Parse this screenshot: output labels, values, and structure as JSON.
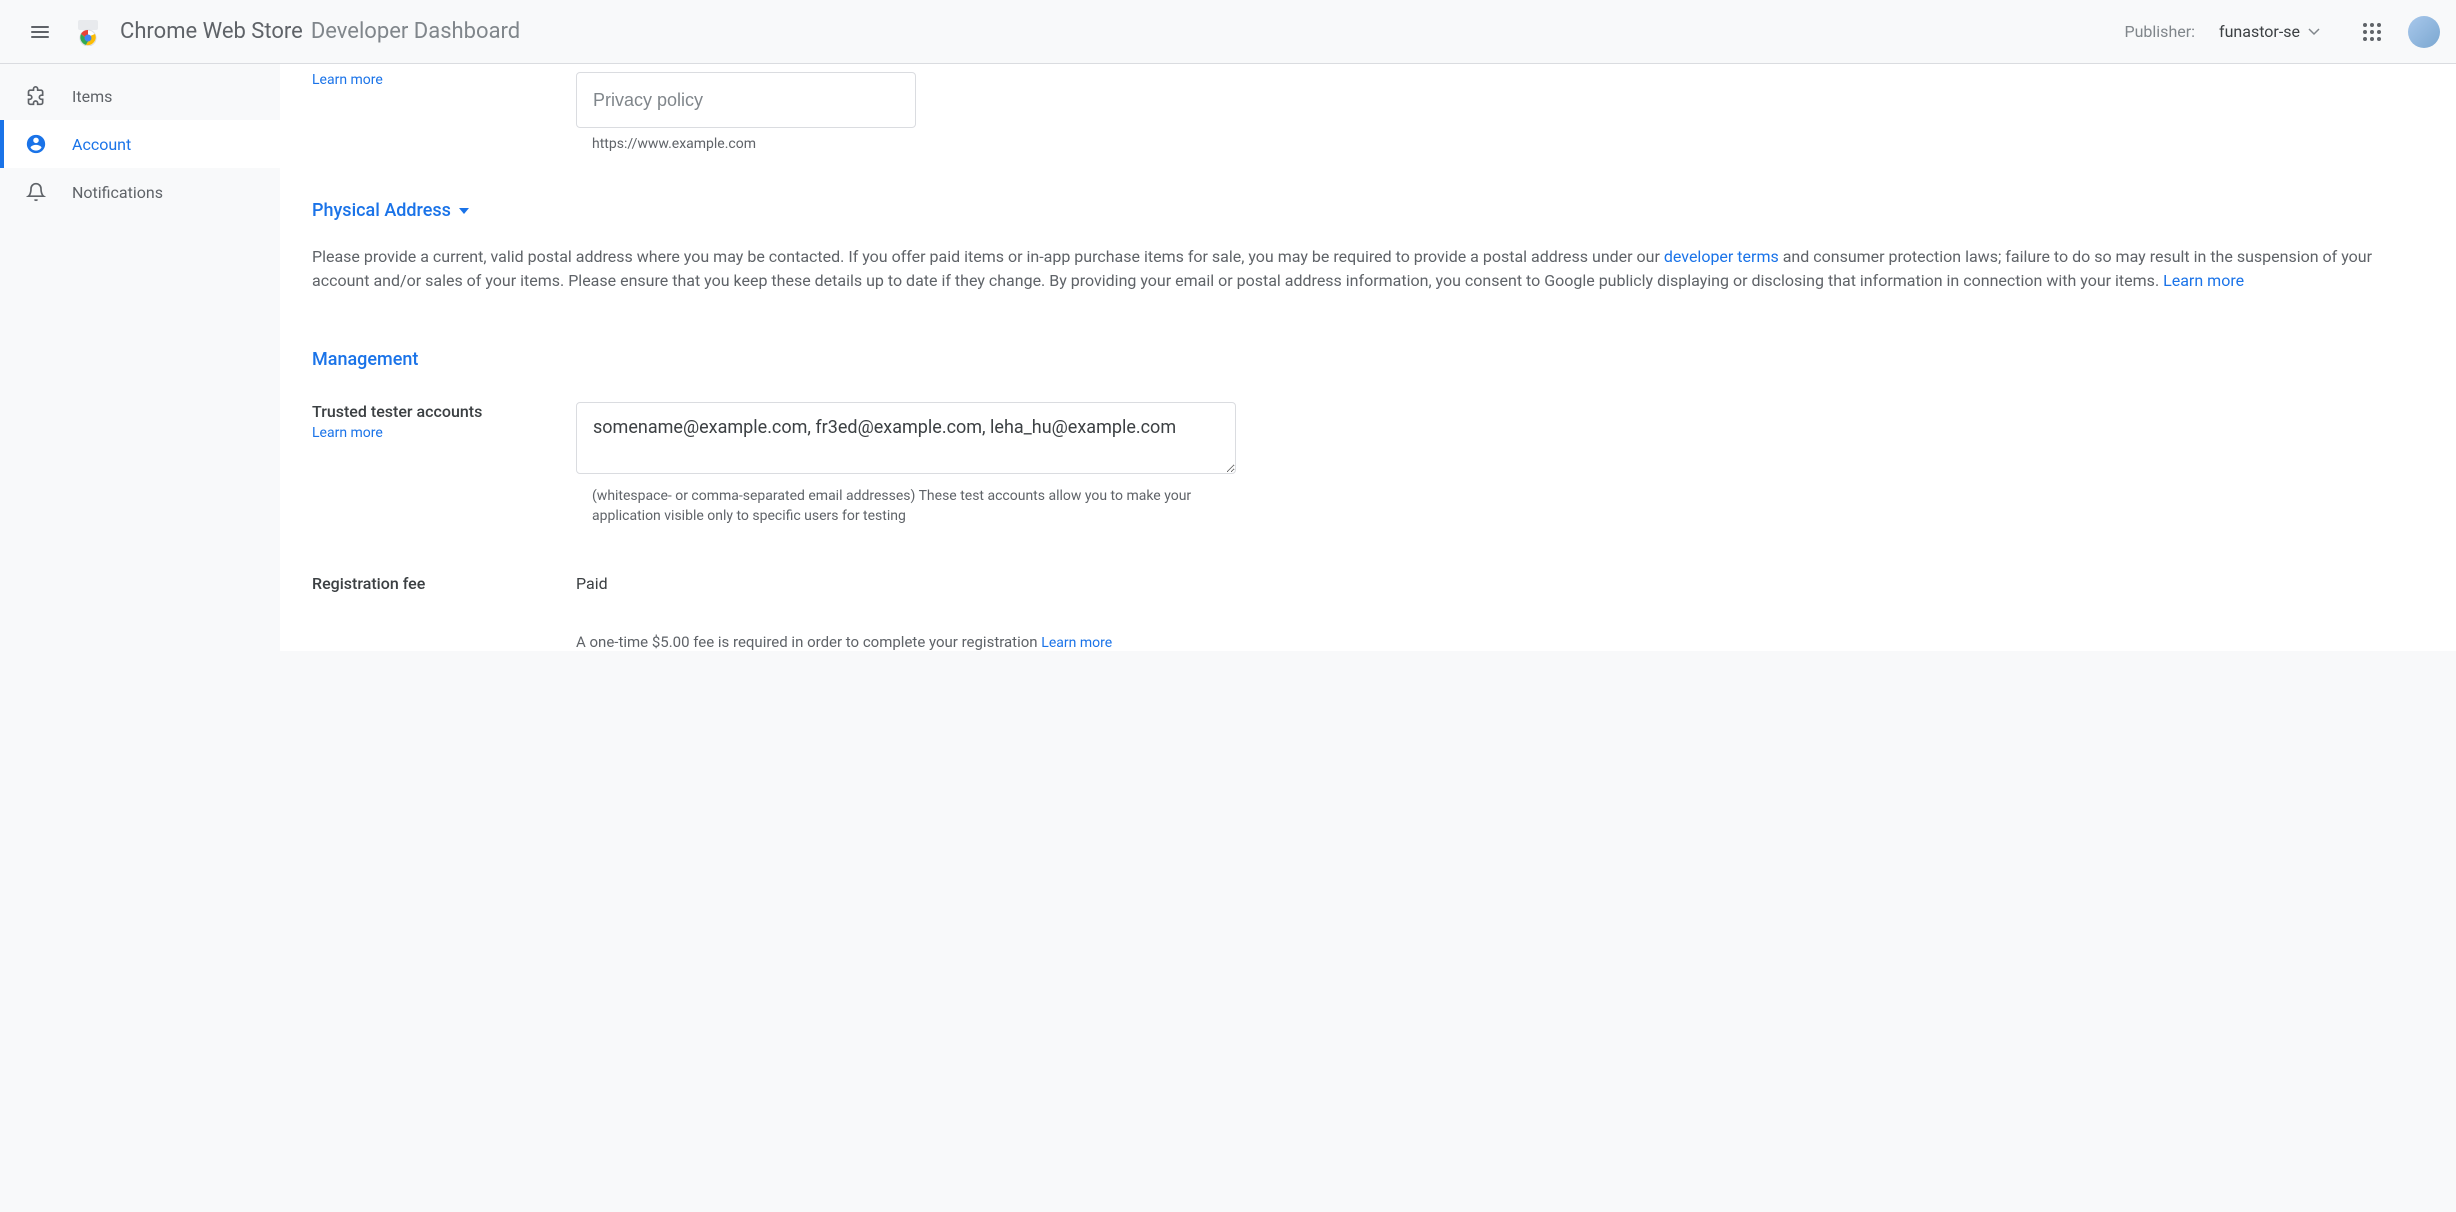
{
  "header": {
    "title_main": "Chrome Web Store",
    "title_sub": "Developer Dashboard",
    "publisher_label": "Publisher:",
    "publisher_value": "funastor-se"
  },
  "sidebar": {
    "items": [
      {
        "label": "Items"
      },
      {
        "label": "Account"
      },
      {
        "label": "Notifications"
      }
    ]
  },
  "privacy": {
    "learn_more": "Learn more",
    "placeholder": "Privacy policy",
    "helper": "https://www.example.com"
  },
  "address": {
    "heading": "Physical Address",
    "desc_p1": "Please provide a current, valid postal address where you may be contacted. If you offer paid items or in-app purchase items for sale, you may be required to provide a postal address under our ",
    "developer_terms": "developer terms",
    "desc_p2": " and consumer protection laws; failure to do so may result in the suspension of your account and/or sales of your items. Please ensure that you keep these details up to date if they change. By providing your email or postal address information, you consent to Google publicly displaying or disclosing that information in connection with your items. ",
    "learn_more": "Learn more"
  },
  "management": {
    "heading": "Management",
    "tester": {
      "title": "Trusted tester accounts",
      "learn_more": "Learn more",
      "value": "somename@example.com, fr3ed@example.com, leha_hu@example.com",
      "helper": "(whitespace- or comma-separated email addresses) These test accounts allow you to make your application visible only to specific users for testing"
    },
    "fee": {
      "title": "Registration fee",
      "status": "Paid",
      "desc": "A one-time $5.00 fee is required in order to complete your registration ",
      "learn_more": "Learn more"
    }
  }
}
